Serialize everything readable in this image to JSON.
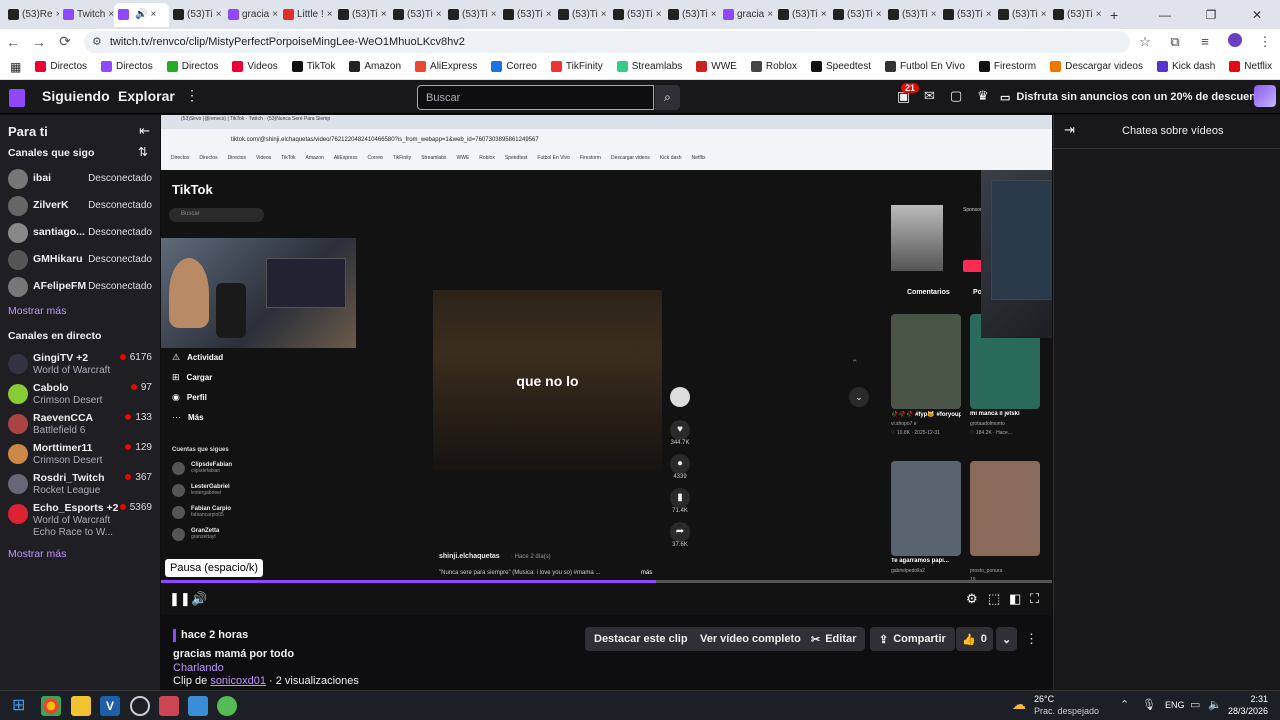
{
  "browser": {
    "tabs": [
      {
        "label": "(53)Re",
        "color": "#222"
      },
      {
        "label": "Twitch",
        "color": "#9147ff"
      },
      {
        "label": "",
        "color": "#9147ff",
        "active": true
      },
      {
        "label": "(53)Ti",
        "color": "#222"
      },
      {
        "label": "gracia",
        "color": "#9147ff"
      },
      {
        "label": "Little !",
        "color": "#e52d27"
      },
      {
        "label": "(53)Ti",
        "color": "#222"
      },
      {
        "label": "(53)Ti",
        "color": "#222"
      },
      {
        "label": "(53)Ti",
        "color": "#222"
      },
      {
        "label": "(53)Ti",
        "color": "#222"
      },
      {
        "label": "(53)Ti",
        "color": "#222"
      },
      {
        "label": "(53)Ti",
        "color": "#222"
      },
      {
        "label": "(53)Ti",
        "color": "#222"
      },
      {
        "label": "gracia",
        "color": "#9147ff"
      },
      {
        "label": "(53)Ti",
        "color": "#222"
      },
      {
        "label": "(53)Ti",
        "color": "#222"
      },
      {
        "label": "(53)Ti",
        "color": "#222"
      },
      {
        "label": "(53)Ti",
        "color": "#222"
      },
      {
        "label": "(53)Ti",
        "color": "#222"
      },
      {
        "label": "(53)Ti",
        "color": "#222"
      }
    ],
    "new_tab": "+",
    "url": "twitch.tv/renvco/clip/MistyPerfectPorpoiseMingLee-WeO1MhuoLKcv8hv2",
    "bookmarks": [
      {
        "label": "Directos",
        "color": "#e03"
      },
      {
        "label": "Directos",
        "color": "#9147ff"
      },
      {
        "label": "Directos",
        "color": "#2a2"
      },
      {
        "label": "Videos",
        "color": "#e03"
      },
      {
        "label": "TikTok",
        "color": "#111"
      },
      {
        "label": "Amazon",
        "color": "#222"
      },
      {
        "label": "AliExpress",
        "color": "#e43"
      },
      {
        "label": "Correo",
        "color": "#1a73e8"
      },
      {
        "label": "TikFinity",
        "color": "#e33"
      },
      {
        "label": "Streamlabs",
        "color": "#3c8"
      },
      {
        "label": "WWE",
        "color": "#c22"
      },
      {
        "label": "Roblox",
        "color": "#444"
      },
      {
        "label": "Speedtest",
        "color": "#111"
      },
      {
        "label": "Futbol En Vivo",
        "color": "#333"
      },
      {
        "label": "Firestorm",
        "color": "#111"
      },
      {
        "label": "Descargar videos",
        "color": "#e70"
      },
      {
        "label": "Kick dash",
        "color": "#53c"
      },
      {
        "label": "Netflix",
        "color": "#e50914"
      }
    ]
  },
  "topnav": {
    "following": "Siguiendo",
    "browse": "Explorar",
    "search_placeholder": "Buscar",
    "notif_count": "21",
    "promo": "Disfruta sin anuncios con un 20% de descuento."
  },
  "sidebar": {
    "for_you": "Para ti",
    "followed_title": "Canales que sigo",
    "followed": [
      {
        "name": "ibai",
        "status": "Desconectado",
        "color": "#777"
      },
      {
        "name": "ZilverK",
        "status": "Desconectado",
        "color": "#666"
      },
      {
        "name": "santiago...",
        "status": "Desconectado",
        "color": "#888"
      },
      {
        "name": "GMHikaru",
        "status": "Desconectado",
        "color": "#555"
      },
      {
        "name": "AFelipeFM",
        "status": "Desconectado",
        "color": "#777"
      }
    ],
    "show_more": "Mostrar más",
    "live_title": "Canales en directo",
    "live": [
      {
        "name": "GingiTV +2",
        "game": "World of Warcraft",
        "viewers": "6176",
        "color": "#334"
      },
      {
        "name": "Cabolo",
        "game": "Crimson Desert",
        "viewers": "97",
        "color": "#8c3"
      },
      {
        "name": "RaevenCCA",
        "game": "Battlefield 6",
        "viewers": "133",
        "color": "#a44"
      },
      {
        "name": "Morttimer11",
        "game": "Crimson Desert",
        "viewers": "129",
        "color": "#c84"
      },
      {
        "name": "Rosdri_Twitch",
        "game": "Rocket League",
        "viewers": "367",
        "color": "#667"
      },
      {
        "name": "Echo_Esports +2",
        "game": "World of Warcraft",
        "game2": "Echo Race to W...",
        "viewers": "5369",
        "color": "#d23"
      }
    ],
    "show_more_live": "Mostrar más"
  },
  "player": {
    "inner_url": "tiktok.com/@shinji.elchaquetas/video/7621220482410466580?is_from_webapp=1&web_id=7607303895861249567",
    "inner_bookmarks": [
      "Directos",
      "Directos",
      "Directos",
      "Videos",
      "TikTok",
      "Amazon",
      "AliExpress",
      "Correo",
      "TikFinity",
      "Streamlabs",
      "WWE",
      "Roblox",
      "Speedtest",
      "Futbol En Vivo",
      "Firestorm",
      "Descargar videos",
      "Kick dash",
      "Netflix"
    ],
    "tiktok_logo": "TikTok",
    "tiktok_search": "Buscar",
    "tk_menu": [
      "Actividad",
      "Cargar",
      "Perfil",
      "Más"
    ],
    "following_title": "Cuentas que sigues",
    "following": [
      {
        "name": "ClipsdeFabian",
        "sub": "clipsdefabian"
      },
      {
        "name": "LesterGabriel",
        "sub": "lestergabrieel"
      },
      {
        "name": "Fabian Carpio",
        "sub": "fabiancarpio05"
      },
      {
        "name": "GranZetta",
        "sub": "granzettayt"
      }
    ],
    "caption": "que no lo",
    "likes": "344.7K",
    "comments": "4339",
    "saves": "71.4K",
    "shares": "37.6K",
    "author": "shinji.elchaquetas",
    "author_time": "· Hace 2 día(s)",
    "description": "\"Nunca sere para siempre\" (Musica: i love you so) #mama ...",
    "desc_more": "más",
    "comments_tab": "Comentarios",
    "comments_tab2": "Po",
    "sponsored": "Sponsored",
    "suggested": [
      {
        "title": "🥀🥀🥀 #fyp🐱 #foryoupage...",
        "user": "vi.shopo7 e",
        "meta": "♡ 10.8K · 2025-12-31",
        "color": "#4a5548"
      },
      {
        "title": "mi manca il jetski",
        "user": "grotaadolmonto",
        "meta": "♡ 184.2K · Hace...",
        "color": "#2a6a5a"
      },
      {
        "title": "Te agarramos papi...",
        "user": "gabrielpedolla2",
        "meta": "",
        "color": "#5a6470"
      },
      {
        "title": "",
        "user": "prosto_ponura",
        "meta": "19",
        "color": "#8a6a5a"
      }
    ],
    "tooltip": "Pausa (espacio/k)",
    "progress": 0.555
  },
  "clip": {
    "time_ago": "hace 2 horas",
    "title": "gracias mamá por todo",
    "category": "Charlando",
    "clip_by_prefix": "Clip de",
    "clipper": "sonicoxd01",
    "views": "· 2 visualizaciones",
    "btn_highlight": "Destacar este clip",
    "btn_full": "Ver vídeo completo",
    "btn_edit": "Editar",
    "btn_share": "Compartir",
    "likes": "0"
  },
  "chat": {
    "title": "Chatea sobre vídeos"
  },
  "taskbar": {
    "temp": "26°C",
    "weather": "Prac. despejado",
    "lang": "ENG",
    "time": "2:31",
    "date": "28/3/2026"
  }
}
